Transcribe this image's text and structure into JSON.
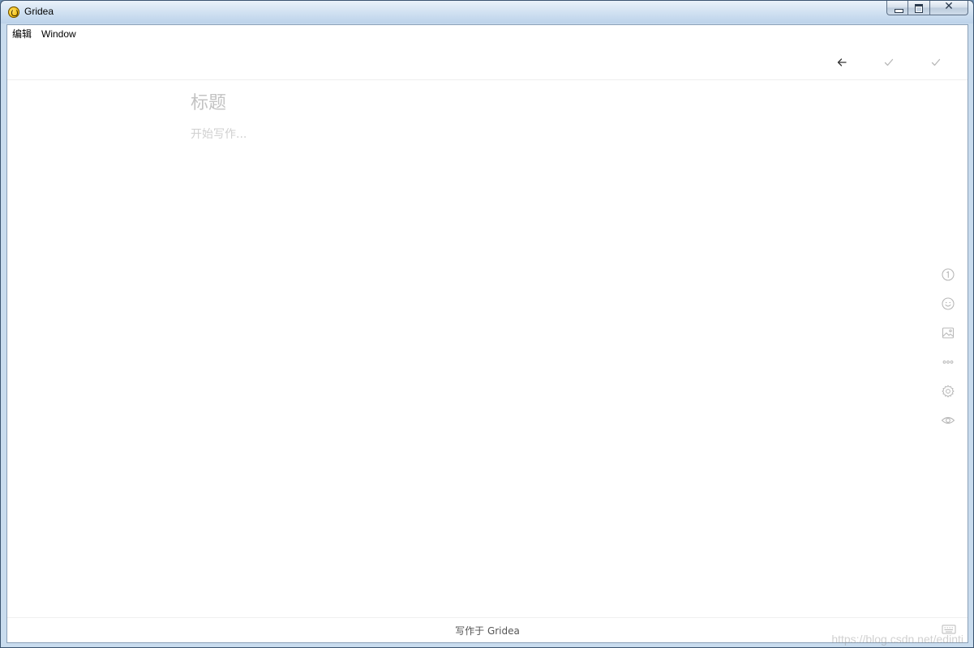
{
  "window": {
    "title": "Gridea",
    "close_glyph": "✕"
  },
  "menu": {
    "items": [
      {
        "label": "编辑"
      },
      {
        "label": "Window"
      }
    ]
  },
  "toolbar": {
    "back_icon": "arrow-left-icon",
    "check_icons": [
      "check-icon",
      "check-icon"
    ]
  },
  "editor": {
    "title_placeholder": "标题",
    "content_placeholder": "开始写作..."
  },
  "sidebar": {
    "icons": [
      "info-icon",
      "emoji-icon",
      "image-icon",
      "more-icon",
      "settings-icon",
      "preview-icon"
    ]
  },
  "footer": {
    "text": "写作于 Gridea",
    "icon": "keyboard-icon"
  },
  "watermark": {
    "text": "https://blog.csdn.net/edinti"
  },
  "colors": {
    "icon": "#b8b8b8",
    "icon_dark": "#333333",
    "placeholder": "#c3c3c3"
  }
}
